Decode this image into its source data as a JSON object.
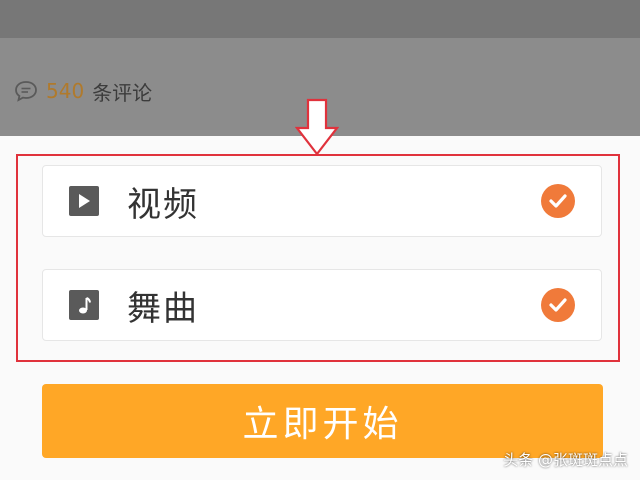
{
  "comments": {
    "count": "540",
    "label": "条评论",
    "icon": "comment-bubble-icon"
  },
  "options": [
    {
      "label": "视频",
      "icon": "play-icon",
      "selected": true
    },
    {
      "label": "舞曲",
      "icon": "music-note-icon",
      "selected": true
    }
  ],
  "start_button": {
    "label": "立即开始"
  },
  "watermark": "头条 @张斑斑点点",
  "colors": {
    "accent": "#ffa726",
    "check": "#f07a3a",
    "annotation": "#e0323c",
    "count": "#b07a2c"
  }
}
